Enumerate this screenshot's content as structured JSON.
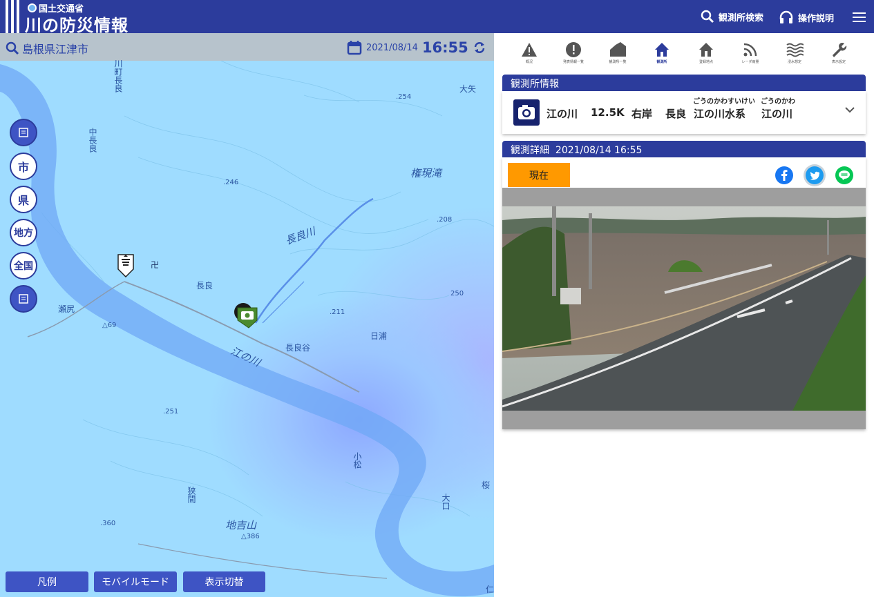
{
  "header": {
    "ministry": "国土交通省",
    "title": "川の防災情報",
    "search_label": "観測所検索",
    "help_label": "操作説明"
  },
  "map": {
    "location": "島根県江津市",
    "date": "2021/08/14",
    "time": "16:55",
    "zoom_buttons": [
      "市",
      "県",
      "地方",
      "全国"
    ],
    "bottom_buttons": [
      "凡例",
      "モバイルモード",
      "表示切替"
    ],
    "labels": [
      "川町長良",
      "中長良",
      "長良",
      "瀬尻",
      "長良川",
      "長良谷",
      "江の川",
      "日浦",
      "権現滝",
      "大矢",
      "小松",
      "狭間",
      "地吉山",
      "大口",
      "桜",
      "仁"
    ],
    "elevations": [
      ".254",
      ".246",
      ".208",
      ".211",
      "250",
      "△69",
      ".251",
      ".360",
      "△386"
    ]
  },
  "nav": {
    "items": [
      "概況",
      "発表情報一覧",
      "観測所一覧",
      "観測所",
      "登録地点",
      "レーダ雨量",
      "浸水想定",
      "表示設定"
    ],
    "active_index": 3
  },
  "station": {
    "section_title": "観測所情報",
    "river": "江の川",
    "distance": "12.5K",
    "bank": "右岸",
    "place": "長良",
    "system": "江の川水系",
    "system_ruby": "ごうのかわすいけい",
    "river2": "江の川",
    "river2_ruby": "ごうのかわ"
  },
  "detail": {
    "title": "観測詳細",
    "datetime": "2021/08/14 16:55",
    "now_label": "現在"
  },
  "colors": {
    "brand": "#2c3c9c",
    "accent": "#ff9900",
    "map_water": "#9fdcff"
  }
}
